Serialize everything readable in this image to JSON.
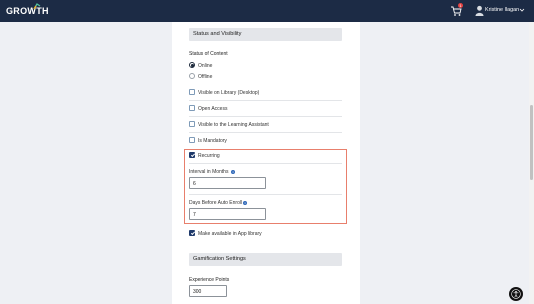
{
  "header": {
    "logo_text": "GROWTH",
    "cart_badge": "1",
    "user_name": "Kristine Ilagan"
  },
  "status_section": {
    "title": "Status and Visibility",
    "status_label": "Status of Content",
    "options": [
      {
        "label": "Online",
        "selected": true
      },
      {
        "label": "Offline",
        "selected": false
      }
    ],
    "checkboxes": [
      {
        "label": "Visible on Library (Desktop)",
        "checked": false
      },
      {
        "label": "Open Access",
        "checked": false
      },
      {
        "label": "Visible to the Learning Assistant",
        "checked": false
      },
      {
        "label": "Is Mandatory",
        "checked": false
      }
    ],
    "recurring": {
      "label": "Recurring",
      "checked": true,
      "interval_label": "Interval in Months",
      "interval_value": "6",
      "days_label": "Days Before Auto Enroll",
      "days_value": "7"
    },
    "app_library": {
      "label": "Make available in App library",
      "checked": true
    }
  },
  "gamification_section": {
    "title": "Gamification Settings",
    "xp_label": "Experience Points",
    "xp_value": "300"
  },
  "colors": {
    "topbar": "#1c2b45",
    "accent": "#1f3a6b",
    "highlight": "#e87f6c",
    "info": "#2f68b8"
  },
  "icons": {
    "logo": "growth-logo-icon",
    "cart": "cart-icon",
    "avatar": "user-avatar-icon",
    "chevron": "chevron-down-icon",
    "info": "info-icon",
    "accessibility": "accessibility-icon"
  }
}
